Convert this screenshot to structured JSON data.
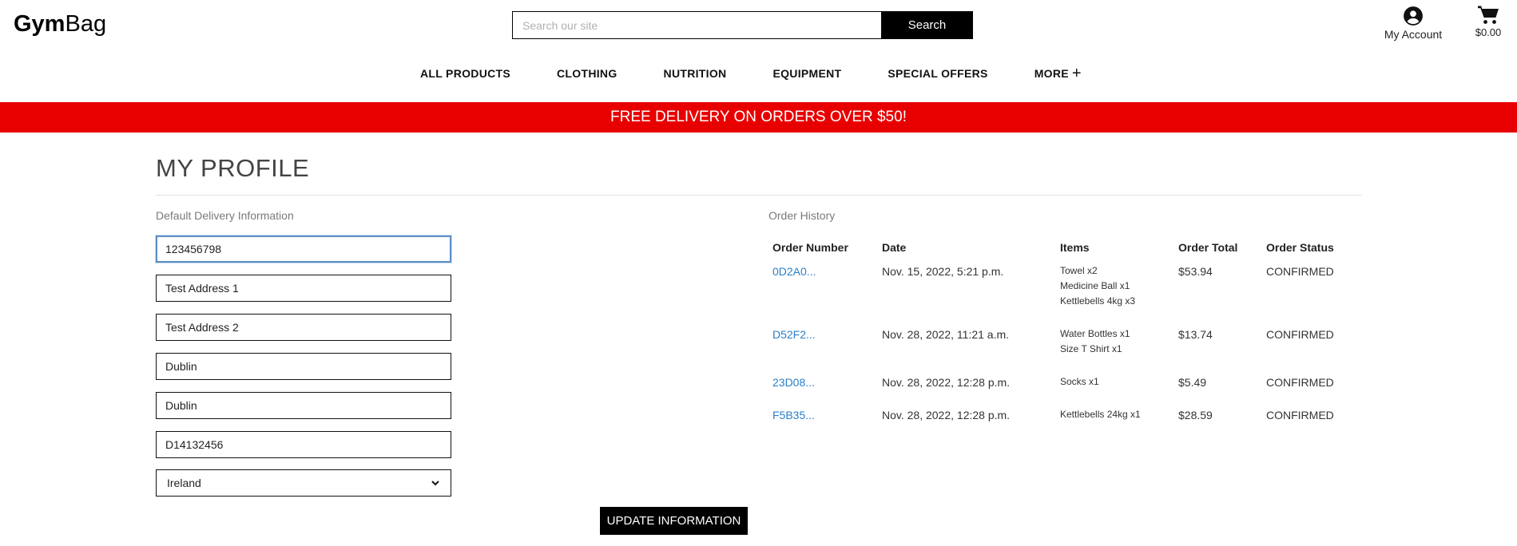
{
  "header": {
    "logo_bold": "Gym",
    "logo_light": "Bag",
    "search_placeholder": "Search our site",
    "search_button": "Search",
    "account_label": "My Account",
    "account_icon": "user-circle-icon",
    "bag_total": "$0.00",
    "bag_icon": "shopping-cart-icon"
  },
  "nav": {
    "items": [
      "ALL PRODUCTS",
      "CLOTHING",
      "NUTRITION",
      "EQUIPMENT",
      "SPECIAL OFFERS",
      "MORE"
    ],
    "more_symbol": "+"
  },
  "banner": {
    "text": "FREE DELIVERY ON ORDERS OVER $50!",
    "color": "#e80000"
  },
  "profile": {
    "title": "MY PROFILE",
    "delivery_label": "Default Delivery Information",
    "fields": {
      "phone": "123456798",
      "address1": "Test Address 1",
      "address2": "Test Address 2",
      "town": "Dublin",
      "county": "Dublin",
      "postcode": "D14132456",
      "country": "Ireland"
    },
    "update_button": "UPDATE INFORMATION"
  },
  "orders": {
    "label": "Order History",
    "headers": [
      "Order Number",
      "Date",
      "Items",
      "Order Total",
      "Order Status"
    ],
    "rows": [
      {
        "number": "0D2A0...",
        "date": "Nov. 15, 2022, 5:21 p.m.",
        "items": [
          "Towel x2",
          "Medicine Ball x1",
          "Kettlebells 4kg x3"
        ],
        "total": "$53.94",
        "status": "CONFIRMED"
      },
      {
        "number": "D52F2...",
        "date": "Nov. 28, 2022, 11:21 a.m.",
        "items": [
          "Water Bottles x1",
          "Size T Shirt x1"
        ],
        "total": "$13.74",
        "status": "CONFIRMED"
      },
      {
        "number": "23D08...",
        "date": "Nov. 28, 2022, 12:28 p.m.",
        "items": [
          "Socks x1"
        ],
        "total": "$5.49",
        "status": "CONFIRMED"
      },
      {
        "number": "F5B35...",
        "date": "Nov. 28, 2022, 12:28 p.m.",
        "items": [
          "Kettlebells 24kg x1"
        ],
        "total": "$28.59",
        "status": "CONFIRMED"
      }
    ],
    "link_color": "#2a7fc9"
  }
}
